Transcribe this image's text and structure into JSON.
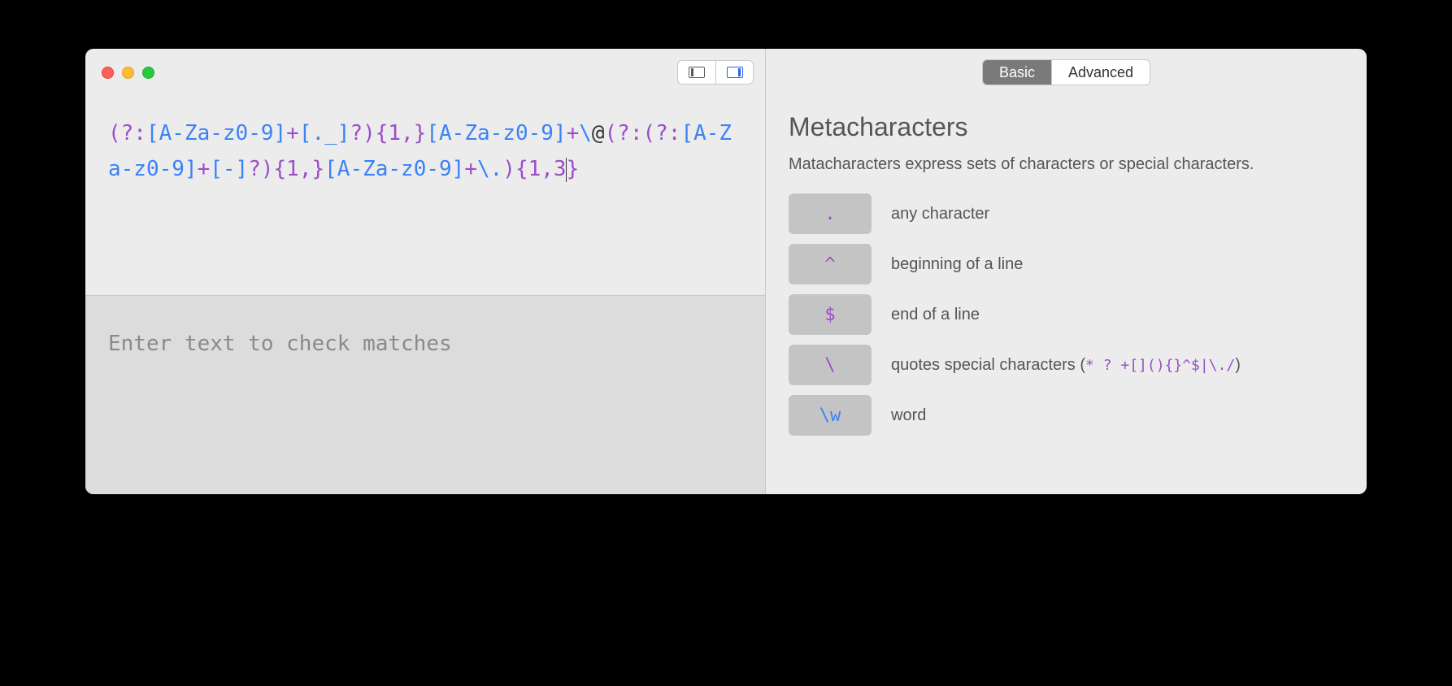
{
  "regex": {
    "tokens": [
      {
        "t": "group",
        "v": "(?:"
      },
      {
        "t": "class",
        "v": "[A-Za-z0-9]"
      },
      {
        "t": "quant",
        "v": "+"
      },
      {
        "t": "class",
        "v": "[._]"
      },
      {
        "t": "quant",
        "v": "?)"
      },
      {
        "t": "quant",
        "v": "{1,}"
      },
      {
        "t": "class",
        "v": "[A-Za-z0-9]"
      },
      {
        "t": "quant",
        "v": "+"
      },
      {
        "t": "escape",
        "v": "\\"
      },
      {
        "t": "lit",
        "v": "@"
      },
      {
        "t": "group",
        "v": "(?:(?:"
      },
      {
        "t": "class",
        "v": "[A-Za-z0-9]"
      },
      {
        "t": "quant",
        "v": "+"
      },
      {
        "t": "class",
        "v": "[-]"
      },
      {
        "t": "quant",
        "v": "?)"
      },
      {
        "t": "quant",
        "v": "{1,}"
      },
      {
        "t": "class",
        "v": "[A-Za-z0-9]"
      },
      {
        "t": "quant",
        "v": "+"
      },
      {
        "t": "escape",
        "v": "\\."
      },
      {
        "t": "quant",
        "v": ")"
      },
      {
        "t": "quant",
        "v": "{1,3}"
      }
    ]
  },
  "test_placeholder": "Enter text to check matches",
  "tabs": {
    "basic": "Basic",
    "advanced": "Advanced",
    "active": "basic"
  },
  "section": {
    "title": "Metacharacters",
    "desc": "Matacharacters express sets of characters or special characters."
  },
  "metacharacters": [
    {
      "sym": ".",
      "cls": "",
      "desc": "any character",
      "special": ""
    },
    {
      "sym": "^",
      "cls": "",
      "desc": "beginning of a line",
      "special": ""
    },
    {
      "sym": "$",
      "cls": "",
      "desc": "end of a line",
      "special": ""
    },
    {
      "sym": "\\",
      "cls": "",
      "desc": "quotes special characters (",
      "special": "* ? +[](){}^$|\\./",
      "desc_after": ")"
    },
    {
      "sym": "\\w",
      "cls": "blue",
      "desc": "word",
      "special": ""
    }
  ]
}
